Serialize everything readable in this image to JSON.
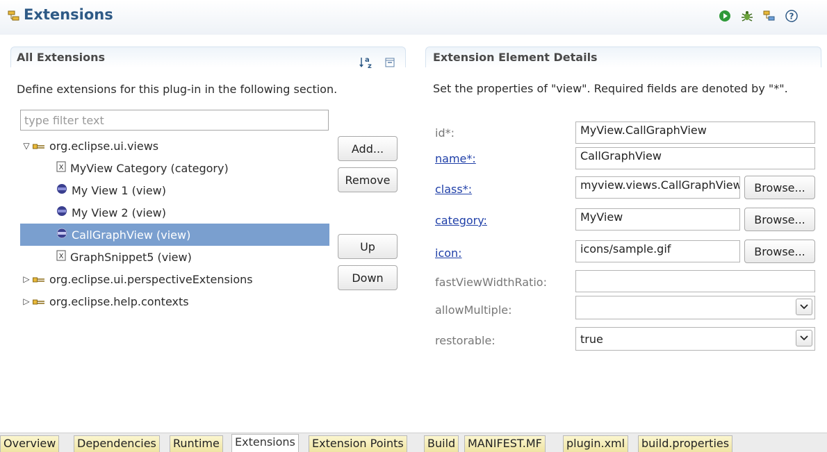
{
  "header": {
    "title": "Extensions"
  },
  "all_extensions": {
    "title": "All Extensions",
    "description": "Define extensions for this plug-in in the following section.",
    "filter_placeholder": "type filter text",
    "tree": [
      {
        "label": "org.eclipse.ui.views",
        "icon": "extension-icon",
        "expanded": true
      },
      {
        "label": "MyView Category (category)",
        "icon": "element-icon"
      },
      {
        "label": "My View 1 (view)",
        "icon": "view-icon"
      },
      {
        "label": "My View 2 (view)",
        "icon": "view-icon"
      },
      {
        "label": "CallGraphView (view)",
        "icon": "view-icon",
        "selected": true
      },
      {
        "label": "GraphSnippet5 (view)",
        "icon": "element-icon"
      },
      {
        "label": "org.eclipse.ui.perspectiveExtensions",
        "icon": "extension-icon",
        "expanded": false
      },
      {
        "label": "org.eclipse.help.contexts",
        "icon": "extension-icon",
        "expanded": false
      }
    ],
    "buttons": {
      "add": "Add...",
      "remove": "Remove",
      "up": "Up",
      "down": "Down"
    }
  },
  "details": {
    "title": "Extension Element Details",
    "description": "Set the properties of \"view\". Required fields are denoted by \"*\".",
    "browse_label": "Browse...",
    "fields": {
      "id": {
        "label": "id*:",
        "value": "MyView.CallGraphView"
      },
      "name": {
        "label": "name*:",
        "value": "CallGraphView"
      },
      "class": {
        "label": "class*:",
        "value": "myview.views.CallGraphView"
      },
      "category": {
        "label": "category:",
        "value": "MyView"
      },
      "icon": {
        "label": "icon:",
        "value": "icons/sample.gif"
      },
      "fastViewWidthRatio": {
        "label": "fastViewWidthRatio:",
        "value": ""
      },
      "allowMultiple": {
        "label": "allowMultiple:",
        "value": ""
      },
      "restorable": {
        "label": "restorable:",
        "value": "true"
      }
    }
  },
  "tabs": [
    {
      "label": "Overview"
    },
    {
      "label": "Dependencies"
    },
    {
      "label": "Runtime"
    },
    {
      "label": "Extensions",
      "active": true
    },
    {
      "label": "Extension Points"
    },
    {
      "label": "Build"
    },
    {
      "label": "MANIFEST.MF"
    },
    {
      "label": "plugin.xml"
    },
    {
      "label": "build.properties"
    }
  ],
  "colors": {
    "accent": "#2e5a86",
    "selection": "#7a9fcf",
    "link": "#1f3fa8"
  }
}
